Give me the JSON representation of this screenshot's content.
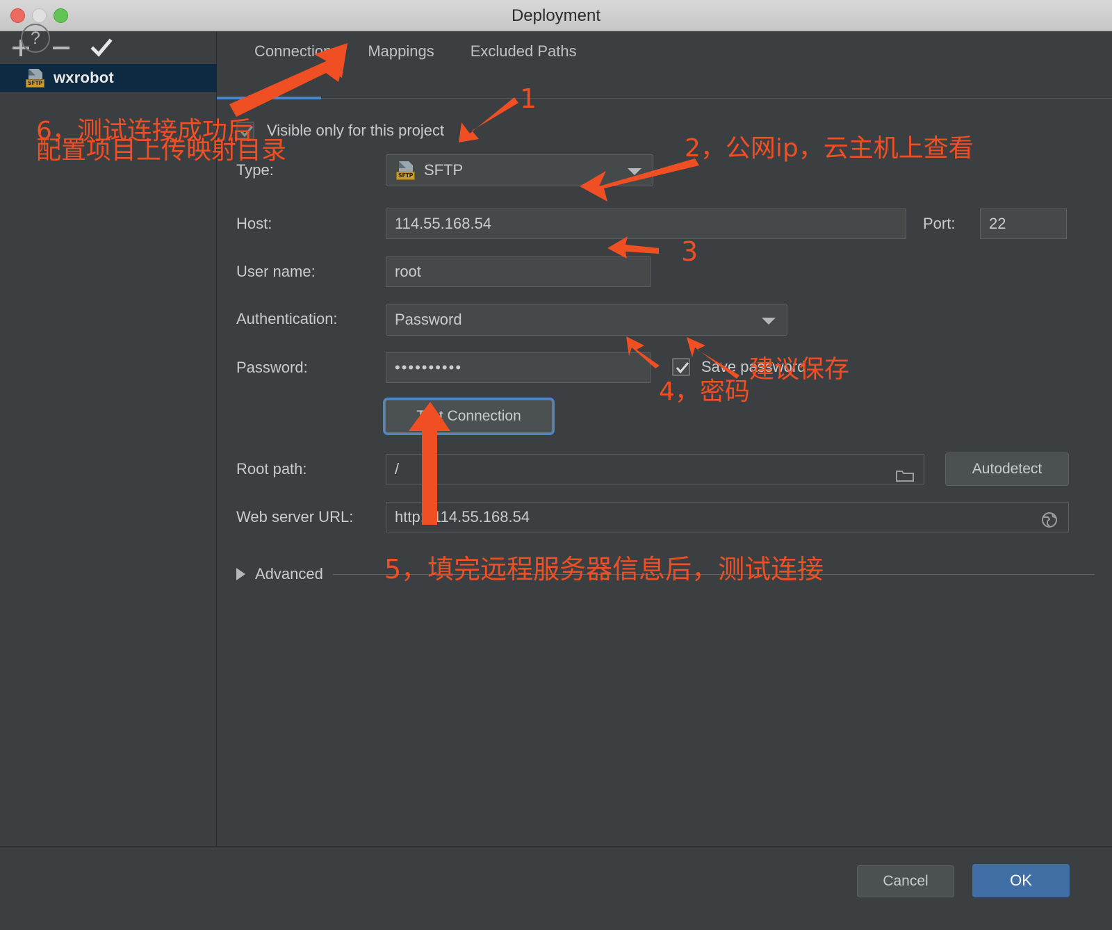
{
  "window": {
    "title": "Deployment",
    "traffic_lights": [
      "close",
      "minimize",
      "zoom"
    ]
  },
  "sidebar": {
    "toolbar": [
      {
        "name": "add",
        "glyph": "+"
      },
      {
        "name": "remove",
        "glyph": "−"
      },
      {
        "name": "apply",
        "glyph": "✓"
      }
    ],
    "items": [
      {
        "label": "wxrobot",
        "icon": "sftp-file-icon",
        "badge": "SFTP",
        "selected": true
      }
    ]
  },
  "tabs": [
    {
      "label": "Connection",
      "active": true
    },
    {
      "label": "Mappings",
      "active": false
    },
    {
      "label": "Excluded Paths",
      "active": false
    }
  ],
  "form": {
    "visible_only": {
      "label": "Visible only for this project",
      "checked": true,
      "enabled": false
    },
    "type": {
      "label": "Type:",
      "value": "SFTP",
      "badge": "SFTP"
    },
    "host": {
      "label": "Host:",
      "value": "114.55.168.54"
    },
    "port": {
      "label": "Port:",
      "value": "22"
    },
    "user_name": {
      "label": "User name:",
      "value": "root"
    },
    "authentication": {
      "label": "Authentication:",
      "value": "Password"
    },
    "password": {
      "label": "Password:",
      "value": "••••••••••"
    },
    "save_password": {
      "label": "Save password",
      "checked": true
    },
    "test_connection": {
      "label": "Test Connection"
    },
    "root_path": {
      "label": "Root path:",
      "value": "/"
    },
    "autodetect": {
      "label": "Autodetect"
    },
    "web_server_url": {
      "label": "Web server URL:",
      "value": "http://114.55.168.54"
    },
    "advanced": {
      "label": "Advanced",
      "expanded": false
    }
  },
  "footer": {
    "help": "?",
    "cancel": "Cancel",
    "ok": "OK"
  },
  "annotations": {
    "color": "#f04e23",
    "items": [
      {
        "id": "a6",
        "line1": "6，测试连接成功后",
        "line2": "配置项目上传映射目录"
      },
      {
        "id": "a1",
        "text": "1"
      },
      {
        "id": "a2",
        "text": "2，公网ip，云主机上查看"
      },
      {
        "id": "a3",
        "text": "3"
      },
      {
        "id": "a4",
        "text": "4，密码"
      },
      {
        "id": "a4b",
        "text": "建议保存"
      },
      {
        "id": "a5",
        "text": "5，填完远程服务器信息后，测试连接"
      }
    ]
  }
}
